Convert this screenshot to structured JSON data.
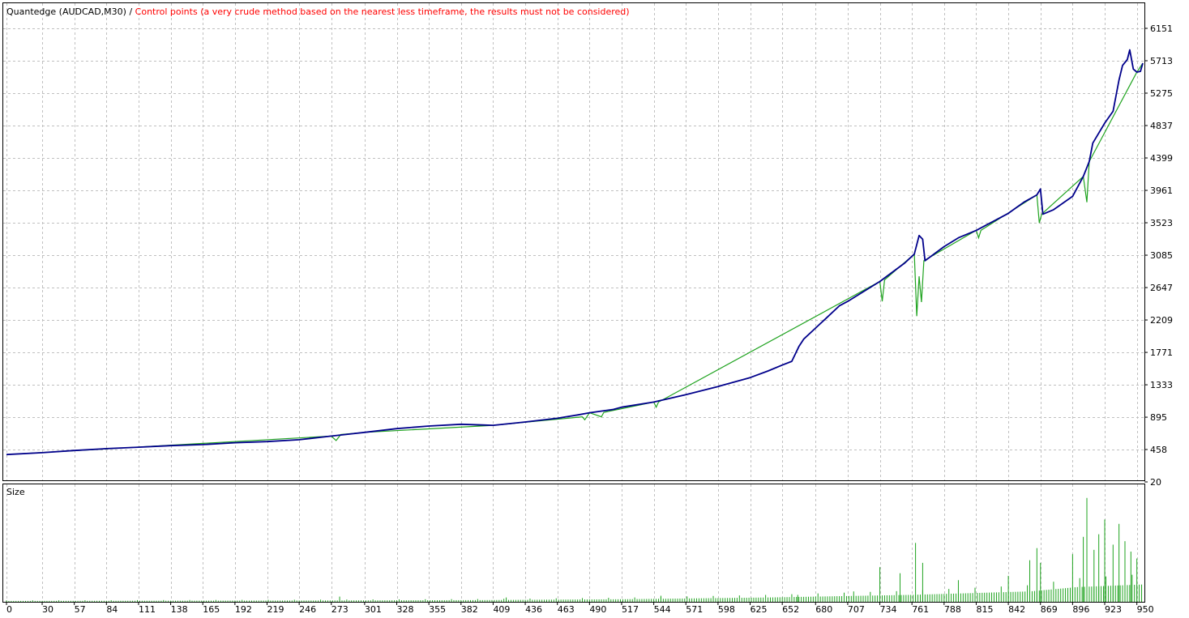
{
  "header": {
    "strategy": "Quantedge (AUDCAD,M30)",
    "separator": " / ",
    "note": "Control points (a very crude method based on the nearest less timeframe, the results must not be considered)"
  },
  "colors": {
    "balance": "#00008b",
    "equity": "#1fa31f",
    "size": "#1fa31f",
    "note": "#ff0000",
    "grid": "#c0c0c0"
  },
  "chart_data": [
    {
      "type": "line",
      "series": [
        {
          "values": [
            [
              0,
              390
            ],
            [
              30,
              415
            ],
            [
              57,
              445
            ],
            [
              84,
              470
            ],
            [
              111,
              490
            ],
            [
              138,
              510
            ],
            [
              165,
              525
            ],
            [
              192,
              550
            ],
            [
              219,
              565
            ],
            [
              246,
              590
            ],
            [
              273,
              640
            ],
            [
              290,
              670
            ],
            [
              301,
              690
            ],
            [
              328,
              740
            ],
            [
              355,
              775
            ],
            [
              382,
              800
            ],
            [
              400,
              790
            ],
            [
              409,
              785
            ],
            [
              436,
              830
            ],
            [
              463,
              880
            ],
            [
              480,
              925
            ],
            [
              490,
              955
            ],
            [
              510,
              1000
            ],
            [
              517,
              1030
            ],
            [
              544,
              1100
            ],
            [
              571,
              1200
            ],
            [
              598,
              1310
            ],
            [
              625,
              1430
            ],
            [
              640,
              1520
            ],
            [
              652,
              1600
            ],
            [
              660,
              1650
            ],
            [
              666,
              1850
            ],
            [
              670,
              1950
            ],
            [
              680,
              2100
            ],
            [
              690,
              2250
            ],
            [
              700,
              2400
            ],
            [
              707,
              2460
            ],
            [
              734,
              2730
            ],
            [
              755,
              2980
            ],
            [
              763,
              3100
            ],
            [
              767,
              3350
            ],
            [
              770,
              3300
            ],
            [
              772,
              3010
            ],
            [
              788,
              3200
            ],
            [
              800,
              3320
            ],
            [
              815,
              3420
            ],
            [
              842,
              3650
            ],
            [
              855,
              3800
            ],
            [
              866,
              3900
            ],
            [
              869,
              3980
            ],
            [
              871,
              3640
            ],
            [
              880,
              3700
            ],
            [
              896,
              3880
            ],
            [
              905,
              4150
            ],
            [
              910,
              4350
            ],
            [
              913,
              4600
            ],
            [
              923,
              4870
            ],
            [
              930,
              5030
            ],
            [
              935,
              5450
            ],
            [
              938,
              5650
            ],
            [
              942,
              5730
            ],
            [
              944,
              5860
            ],
            [
              947,
              5600
            ],
            [
              950,
              5560
            ],
            [
              953,
              5570
            ],
            [
              955,
              5680
            ]
          ]
        },
        {
          "values": [
            [
              0,
              390
            ],
            [
              273,
              640
            ],
            [
              277,
              580
            ],
            [
              281,
              660
            ],
            [
              301,
              690
            ],
            [
              409,
              785
            ],
            [
              484,
              900
            ],
            [
              486,
              860
            ],
            [
              490,
              955
            ],
            [
              500,
              900
            ],
            [
              502,
              960
            ],
            [
              544,
              1100
            ],
            [
              546,
              1030
            ],
            [
              548,
              1100
            ],
            [
              734,
              2730
            ],
            [
              736,
              2460
            ],
            [
              738,
              2750
            ],
            [
              763,
              3100
            ],
            [
              765,
              2260
            ],
            [
              767,
              2800
            ],
            [
              769,
              2450
            ],
            [
              771,
              3010
            ],
            [
              815,
              3420
            ],
            [
              817,
              3320
            ],
            [
              819,
              3420
            ],
            [
              866,
              3900
            ],
            [
              868,
              3520
            ],
            [
              870,
              3640
            ],
            [
              905,
              4150
            ],
            [
              908,
              3800
            ],
            [
              910,
              4350
            ],
            [
              950,
              5560
            ],
            [
              955,
              5680
            ]
          ]
        }
      ],
      "y_ticks": [
        20,
        458,
        895,
        1333,
        1771,
        2209,
        2647,
        3085,
        3523,
        3961,
        4399,
        4837,
        5275,
        5713,
        6151
      ],
      "x_ticks": [
        0,
        30,
        57,
        84,
        111,
        138,
        165,
        192,
        219,
        246,
        273,
        301,
        328,
        355,
        382,
        409,
        436,
        463,
        490,
        517,
        544,
        571,
        598,
        625,
        652,
        680,
        707,
        734,
        761,
        788,
        815,
        842,
        869,
        896,
        923,
        950
      ],
      "xlim": [
        0,
        955
      ],
      "ylim": [
        20,
        6151
      ],
      "grid": true
    },
    {
      "type": "bar",
      "title": "Size",
      "values_description_levels": {
        "base": [
          [
            0,
            1
          ],
          [
            245,
            1.5
          ],
          [
            400,
            2
          ],
          [
            520,
            3
          ],
          [
            640,
            5
          ],
          [
            760,
            8
          ],
          [
            860,
            12
          ],
          [
            900,
            17
          ],
          [
            955,
            20
          ]
        ],
        "spikes": [
          [
            280,
            6
          ],
          [
            420,
            5
          ],
          [
            550,
            7
          ],
          [
            665,
            8
          ],
          [
            712,
            12
          ],
          [
            734,
            40
          ],
          [
            751,
            33
          ],
          [
            764,
            68
          ],
          [
            770,
            45
          ],
          [
            800,
            25
          ],
          [
            842,
            30
          ],
          [
            860,
            48
          ],
          [
            866,
            62
          ],
          [
            869,
            45
          ],
          [
            896,
            55
          ],
          [
            905,
            75
          ],
          [
            908,
            120
          ],
          [
            914,
            60
          ],
          [
            918,
            78
          ],
          [
            923,
            95
          ],
          [
            930,
            66
          ],
          [
            935,
            90
          ],
          [
            940,
            70
          ],
          [
            945,
            58
          ],
          [
            950,
            50
          ]
        ]
      },
      "ylim": [
        0,
        130
      ],
      "grid": true
    }
  ]
}
